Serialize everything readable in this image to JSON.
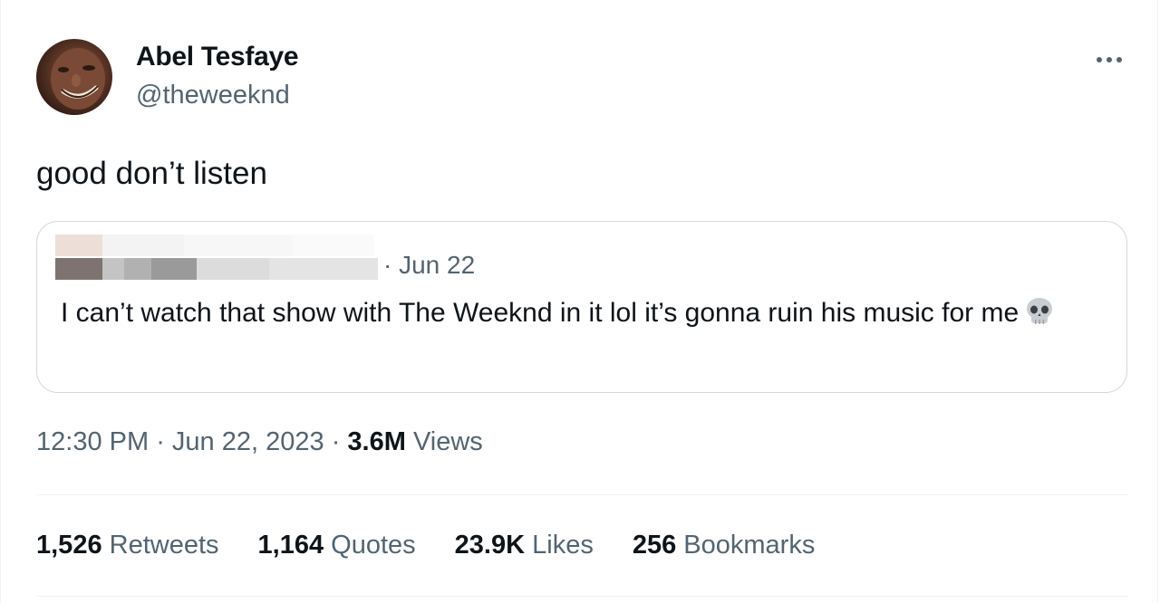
{
  "author": {
    "display_name": "Abel Tesfaye",
    "handle": "@theweeknd"
  },
  "tweet": {
    "text": "good don’t listen",
    "time": "12:30 PM",
    "date": "Jun 22, 2023",
    "views_count": "3.6M",
    "views_label": "Views"
  },
  "quoted_tweet": {
    "date": "Jun 22",
    "text": "I can’t watch that show with The Weeknd in it lol it’s gonna ruin his music for me",
    "emoji_icon": "skull-icon"
  },
  "stats": [
    {
      "count": "1,526",
      "label": "Retweets"
    },
    {
      "count": "1,164",
      "label": "Quotes"
    },
    {
      "count": "23.9K",
      "label": "Likes"
    },
    {
      "count": "256",
      "label": "Bookmarks"
    }
  ],
  "colors": {
    "text_primary": "#0f1419",
    "text_secondary": "#536471",
    "border": "#cfd9de",
    "divider": "#eff3f4"
  }
}
